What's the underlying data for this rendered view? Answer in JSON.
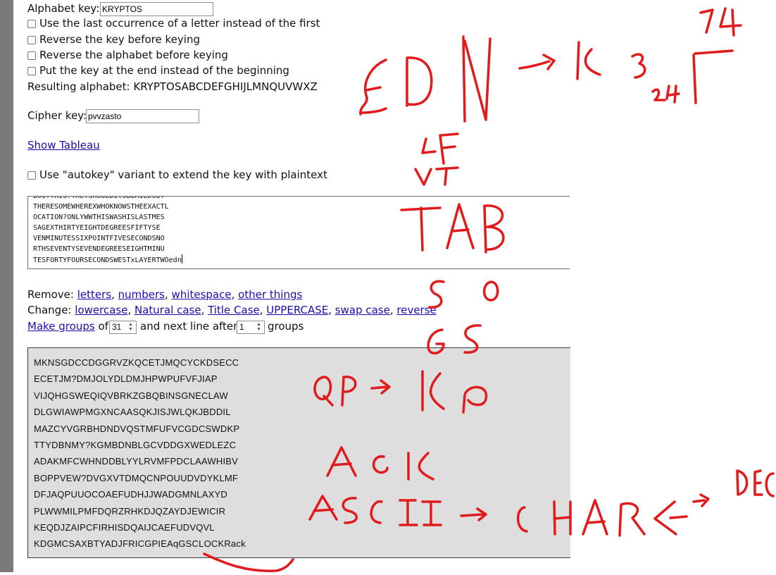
{
  "alphabet": {
    "label": "Alphabet key:",
    "value": "KRYPTOS",
    "options": [
      "Use the last occurrence of a letter instead of the first",
      "Reverse the key before keying",
      "Reverse the alphabet before keying",
      "Put the key at the end instead of the beginning"
    ],
    "resulting_label": "Resulting alphabet:",
    "resulting_value": "KRYPTOSABCDEFGHIJLMNQUVWXZ"
  },
  "cipher": {
    "label": "Cipher key:",
    "value": "pvvzasto"
  },
  "tableau_link": "Show Tableau",
  "autokey_label": "Use \"autokey\" variant to extend the key with plaintext",
  "input_lines": [
    "BOUTTHIS?THEYSHOULDITSBURIEDOUT",
    "THERESOMEWHEREXWHOKNOWSTHEEXACTL",
    "OCATION?ONLYWWTHISWASHISLASTMES",
    "SAGEXTHIRTYEIGHTDEGREESFIFTYSE",
    "VENMINUTESSIXPOINTFIVESECONDSNO",
    "RTHSEVENTYSEVENDEGREESEIGHTMINU",
    "TESFORTYFOURSECONDSWESTxLAYERTWOedn"
  ],
  "tools": {
    "remove_label": "Remove:",
    "remove_links": [
      "letters",
      "numbers",
      "whitespace",
      "other things"
    ],
    "change_label": "Change:",
    "change_links": [
      "lowercase",
      "Natural case",
      "Title Case",
      "UPPERCASE",
      "swap case",
      "reverse"
    ],
    "groups_link": "Make groups",
    "of_text": "of",
    "group_size": "31",
    "next_line_text": "and next line after",
    "line_groups": "1",
    "groups_text": "groups"
  },
  "output_lines": [
    "MKNSGDCCDGGRVZKQCETJMQCYCKDSECC",
    "ECETJM?DMJOLYDLDMJHPWPUFVFJIAP",
    "VIJQHGSWEQIQVBRKZGBQBINSGNECLAW",
    "DLGWIAWPMGXNCAASQKJISJWLQKJBDDIL",
    "MAZCYVGRBHDNDVQSTMFUFVCGDCSWDKP",
    "TTYDBNMY?KGMBDNBLGCVDDGXWEDLEZC",
    "ADAKMFCWHNDDBLYYLRVMFPDCLAAWHIBV",
    "BOPPVEW?DVGXVTDMQCNPOUUDVDYKLMF",
    "DFJAQPUUOCOAEFUDHJJWADGMNLAXYD",
    "PLWWMILPMFDQRZRHKDJQZAYDJEWICIR",
    "KEQDJZAIPCFIRHISDQAIJCAEFUDVQVL",
    "KDGMCSAXBTYADJFRICGPIEAqGSCLOCKRack"
  ],
  "handwritten_notes": [
    "EDN",
    "K",
    "3",
    "24",
    "14",
    "LF",
    "VT",
    "TAB",
    "SO",
    "GS",
    "QR",
    "KR",
    "ACK",
    "ASCII",
    "CHAR",
    "DEC"
  ],
  "colors": {
    "link": "#1a0dab",
    "ink": "#e11b1b",
    "output_bg": "#dedede",
    "side_bar": "#7a7a7a"
  }
}
